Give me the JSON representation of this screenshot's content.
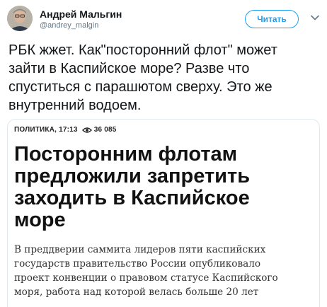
{
  "author": {
    "name": "Андрей Мальгин",
    "handle": "@andrey_malgin",
    "follow_label": "Читать"
  },
  "tweet": {
    "text": "РБК жжет. Как\"посторонний флот\" может\nзайти в Каспийское море? Разве что\nспуститься с парашютом сверху. Это же\nвнутренний водоем."
  },
  "card": {
    "category_time": "ПОЛИТИКА, 17:13",
    "views": "36 085",
    "title": "Посторонним флотам\nпредложили запретить\nзаходить в Каспийское\nморе",
    "lead": "В преддверии саммита лидеров пяти каспийских\nгосударств правительство России опубликовало\nпроект конвенции о правовом статусе Каспийского\nморя, работа над которой велась больше 20 лет"
  },
  "colors": {
    "accent": "#1da1f2",
    "text": "#14171a",
    "secondary": "#657786",
    "border": "#e1e8ed"
  },
  "icons": [
    "avatar",
    "chevron-down-icon",
    "eye-icon"
  ]
}
